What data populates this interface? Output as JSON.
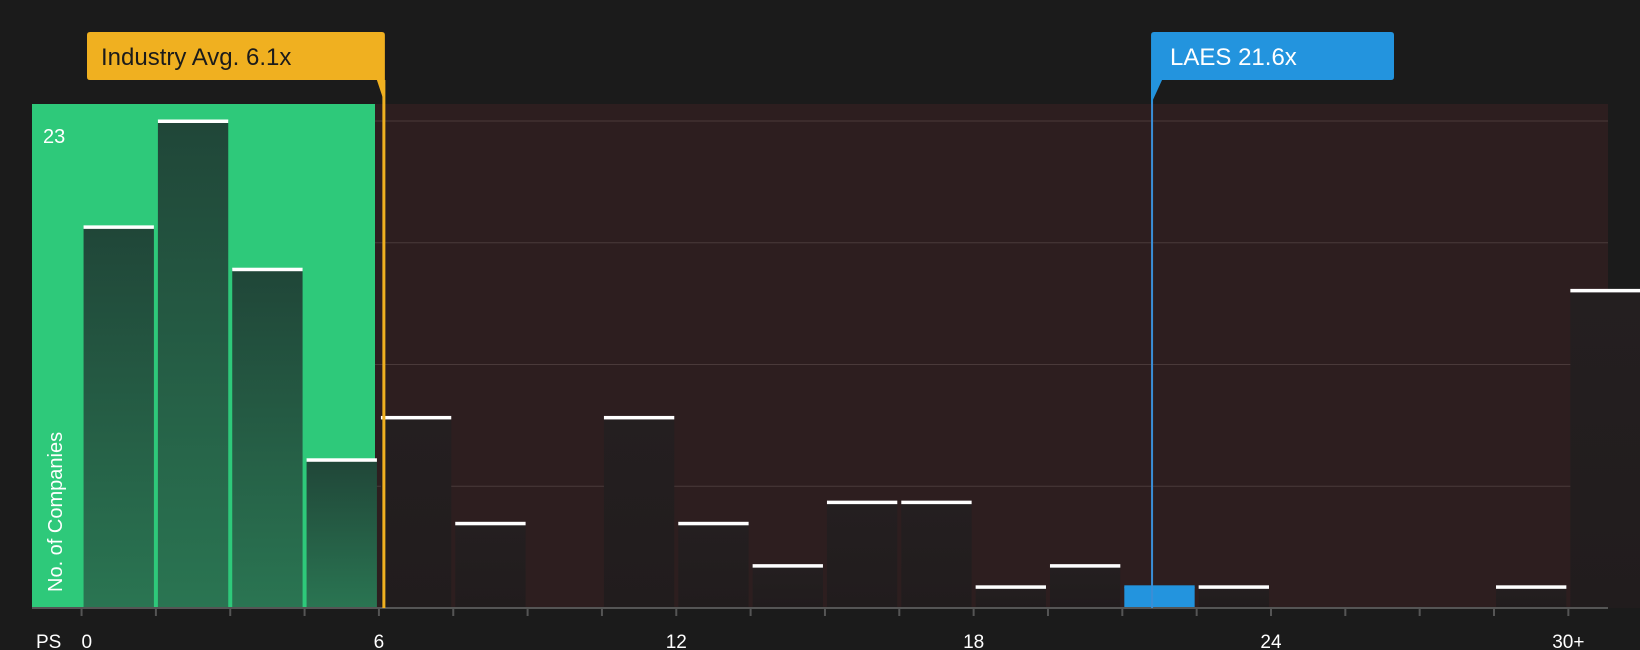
{
  "chart_data": {
    "type": "bar",
    "xlabel": "PS",
    "ylabel": "No. of Companies",
    "x_tick_labels": [
      "0",
      "6",
      "12",
      "18",
      "24",
      "30+"
    ],
    "x_tick_values": [
      0,
      6,
      12,
      18,
      24,
      30
    ],
    "y_top_label": "23",
    "ylim": [
      0,
      23
    ],
    "xlim": [
      -1,
      30.8
    ],
    "bin_width": 1.5,
    "bins": [
      {
        "x0": 0,
        "count": 18
      },
      {
        "x0": 1.5,
        "count": 23
      },
      {
        "x0": 3,
        "count": 16
      },
      {
        "x0": 4.5,
        "count": 7
      },
      {
        "x0": 6,
        "count": 9
      },
      {
        "x0": 7.5,
        "count": 4
      },
      {
        "x0": 9,
        "count": 0
      },
      {
        "x0": 10.5,
        "count": 9
      },
      {
        "x0": 12,
        "count": 4
      },
      {
        "x0": 13.5,
        "count": 2
      },
      {
        "x0": 15,
        "count": 5
      },
      {
        "x0": 16.5,
        "count": 5
      },
      {
        "x0": 18,
        "count": 1
      },
      {
        "x0": 19.5,
        "count": 2
      },
      {
        "x0": 21,
        "count": 1
      },
      {
        "x0": 22.5,
        "count": 1
      },
      {
        "x0": 24,
        "count": 0
      },
      {
        "x0": 25.5,
        "count": 0
      },
      {
        "x0": 27,
        "count": 0
      },
      {
        "x0": 28.5,
        "count": 1
      },
      {
        "x0": 30,
        "count": 15
      }
    ],
    "industry_avg": {
      "label": "Industry Avg. 6.1x",
      "value": 6.1
    },
    "company": {
      "label": "LAES 21.6x",
      "value": 21.6
    },
    "grid": true,
    "colors": {
      "background": "#1b1b1b",
      "below_avg_region": "#2ec97a",
      "above_avg_region": "#2d1e1f",
      "bar_below": "#1f4a38",
      "bar_above": "#232020",
      "bar_cap": "#ffffff",
      "company_bar": "#2394de",
      "avg_line": "#f0b020",
      "company_line": "#3a8ed6",
      "axis_text": "#ffffff",
      "grid": "#4a3a3a"
    }
  }
}
